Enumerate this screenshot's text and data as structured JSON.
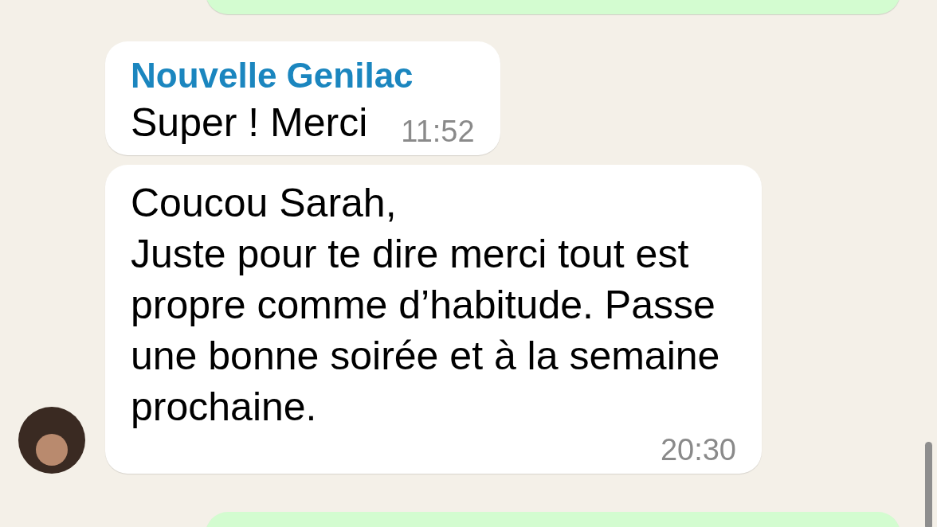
{
  "messages": [
    {
      "kind": "outgoing"
    },
    {
      "kind": "incoming",
      "sender": "Nouvelle Genilac",
      "text": "Super ! Merci",
      "time": "11:52",
      "avatar": false
    },
    {
      "kind": "incoming",
      "text": "Coucou Sarah,\nJuste pour te dire merci tout est propre comme d’habitude. Passe une bonne soirée et à la semaine prochaine.",
      "time": "20:30",
      "avatar": true
    },
    {
      "kind": "outgoing"
    }
  ]
}
